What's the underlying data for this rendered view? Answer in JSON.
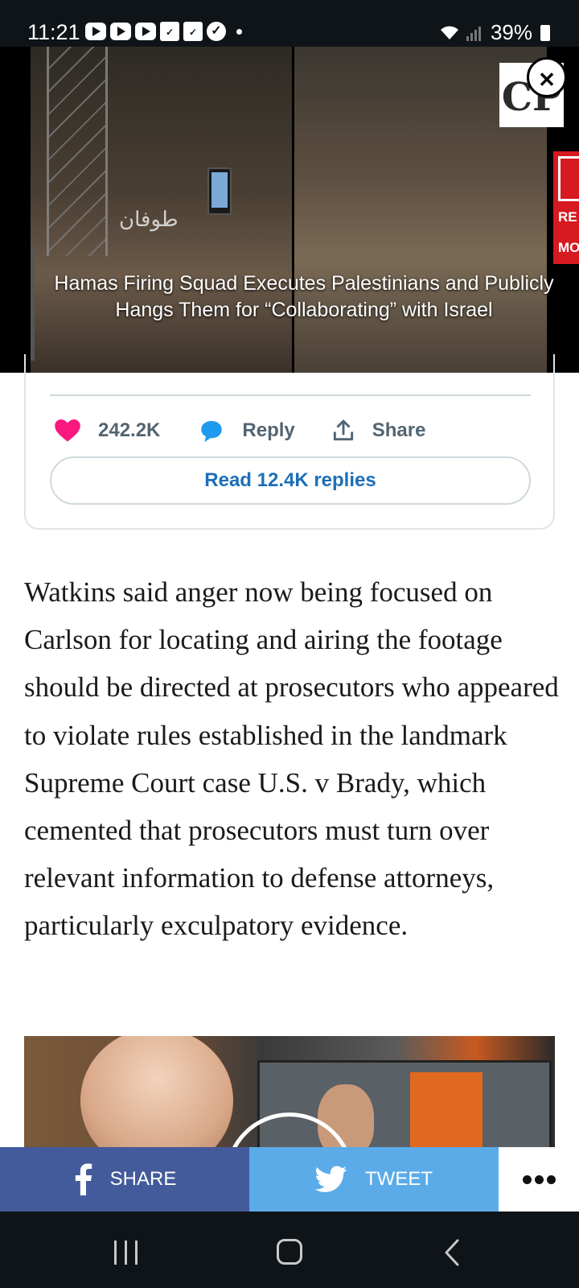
{
  "status_bar": {
    "time": "11:21",
    "notification_icons": [
      "youtube-icon",
      "youtube-icon",
      "youtube-icon",
      "callfilter-icon",
      "callfilter-icon",
      "check-icon",
      "dot-icon"
    ],
    "battery": "39%"
  },
  "ad": {
    "caption": "Hamas Firing Squad Executes Palestinians and Publicly Hangs Them for “Collaborating” with Israel",
    "logo_text": "CP",
    "side_banner_lines": [
      "RE",
      "MO"
    ]
  },
  "tweet": {
    "like_count": "242.2K",
    "reply_label": "Reply",
    "share_label": "Share",
    "read_replies_label": "Read 12.4K replies"
  },
  "article": {
    "paragraph": "Watkins said anger now being focused on Carlson for locating and airing the footage should be directed at prosecutors who appeared to violate rules established in the landmark Supreme Court case U.S. v Brady, which cemented that prosecutors must turn over relevant information to defense attorneys, particularly exculpatory evidence."
  },
  "share_bar": {
    "facebook_label": "SHARE",
    "twitter_label": "TWEET"
  },
  "colors": {
    "heart": "#f91880",
    "reply_bubble": "#1d9bf0",
    "read_link": "#1d6fb8",
    "facebook": "#435a9b",
    "twitter": "#5aabe8",
    "system_bar": "#0f1419"
  }
}
